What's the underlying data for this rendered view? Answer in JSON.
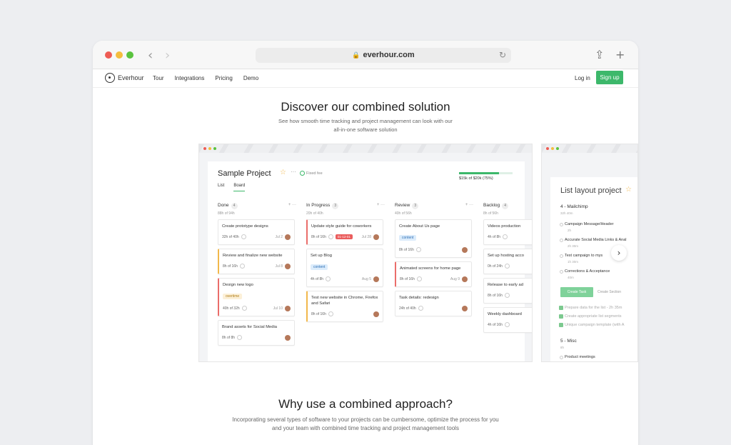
{
  "browser": {
    "url": "everhour.com"
  },
  "site_nav": {
    "brand": "Everhour",
    "links": [
      "Tour",
      "Integrations",
      "Pricing",
      "Demo"
    ],
    "login": "Log in",
    "signup": "Sign up"
  },
  "hero": {
    "title": "Discover our combined solution",
    "subtitle_line1": "See how smooth time tracking and project management can look with our",
    "subtitle_line2": "all-in-one software solution"
  },
  "board": {
    "project_title": "Sample Project",
    "fixed_fee": "Fixed fee",
    "tabs": [
      "List",
      "Board"
    ],
    "active_tab": "Board",
    "budget_text": "$15k of $20k (75%)",
    "budget_progress": 0.75,
    "columns": [
      {
        "name": "Done",
        "count": "4",
        "sub": "88h of 94h",
        "cards": [
          {
            "title": "Create prototype designs",
            "meta": "32h of 40h",
            "date": "Jul 2",
            "accent": "",
            "tag": "",
            "tag_style": ""
          },
          {
            "title": "Review and finalize new website",
            "meta": "8h of 16h",
            "date": "Jul 8",
            "accent": "orange",
            "tag": "",
            "tag_style": ""
          },
          {
            "title": "Design new logo",
            "meta": "40h of 32h",
            "date": "Jul 10",
            "accent": "red",
            "tag": "overtime",
            "tag_style": "yellow"
          },
          {
            "title": "Brand assets for Social Media",
            "meta": "8h of 8h",
            "date": "",
            "accent": "",
            "tag": "",
            "tag_style": ""
          }
        ]
      },
      {
        "name": "In Progress",
        "count": "3",
        "sub": "20h of 40h",
        "cards": [
          {
            "title": "Update style guide for coworkers",
            "meta": "8h of 16h",
            "date": "Jul 28",
            "accent": "red",
            "tag": "",
            "tag_style": "",
            "badge": "01-12-01"
          },
          {
            "title": "Set up Blog",
            "meta": "4h of 8h",
            "date": "Aug 5",
            "accent": "",
            "tag": "content",
            "tag_style": "blue"
          },
          {
            "title": "Test new website in Chrome, Firefox and Safari",
            "meta": "8h of 16h",
            "date": "",
            "accent": "orange",
            "tag": "",
            "tag_style": ""
          }
        ]
      },
      {
        "name": "Review",
        "count": "3",
        "sub": "40h of 56h",
        "cards": [
          {
            "title": "Create About Us page",
            "meta": "8h of 16h",
            "date": "",
            "accent": "",
            "tag": "content",
            "tag_style": "blue"
          },
          {
            "title": "Animated screens for home page",
            "meta": "8h of 16h",
            "date": "Aug 9",
            "accent": "red",
            "tag": "",
            "tag_style": ""
          },
          {
            "title": "Task details: redesign",
            "meta": "24h of 40h",
            "date": "",
            "accent": "",
            "tag": "",
            "tag_style": ""
          }
        ]
      },
      {
        "name": "Backlog",
        "count": "4",
        "sub": "8h of 56h",
        "cards": [
          {
            "title": "Videos production",
            "meta": "4h of 8h",
            "date": "",
            "accent": "",
            "tag": "",
            "tag_style": ""
          },
          {
            "title": "Set up hosting acco",
            "meta": "0h of 24h",
            "date": "",
            "accent": "",
            "tag": "",
            "tag_style": ""
          },
          {
            "title": "Release to early ad",
            "meta": "8h of 16h",
            "date": "",
            "accent": "",
            "tag": "",
            "tag_style": ""
          },
          {
            "title": "Weekly dashboard",
            "meta": "4h of 16h",
            "date": "",
            "accent": "",
            "tag": "",
            "tag_style": ""
          }
        ]
      }
    ]
  },
  "list_layout": {
    "title": "List layout project",
    "section1": "4 - Mailchimp",
    "section1_sub": "32h 40m",
    "items": [
      {
        "label": "Campaign Message/Header",
        "meta": "2h"
      },
      {
        "label": "Accurate Social Media Links & Anal",
        "meta": "2h 30m"
      },
      {
        "label": "Test campaign to mys",
        "meta": "1h 30m"
      },
      {
        "label": "Corrections & Acceptance",
        "meta": "40m"
      }
    ],
    "create_task": "Create Task",
    "create_section": "Create Section",
    "done_items": [
      "Prepare data for the list - 2h 35m",
      "Create appropriate list segments",
      "Unique campaign template (with A"
    ],
    "section2": "5 - Misc",
    "section2_sub": "8h",
    "section2_item": "Product meetings"
  },
  "why": {
    "title": "Why use a combined approach?",
    "line1": "Incorporating several types of software to your projects can be cumbersome, optimize the process for you",
    "line2": "and your team with combined time tracking and project management tools"
  }
}
